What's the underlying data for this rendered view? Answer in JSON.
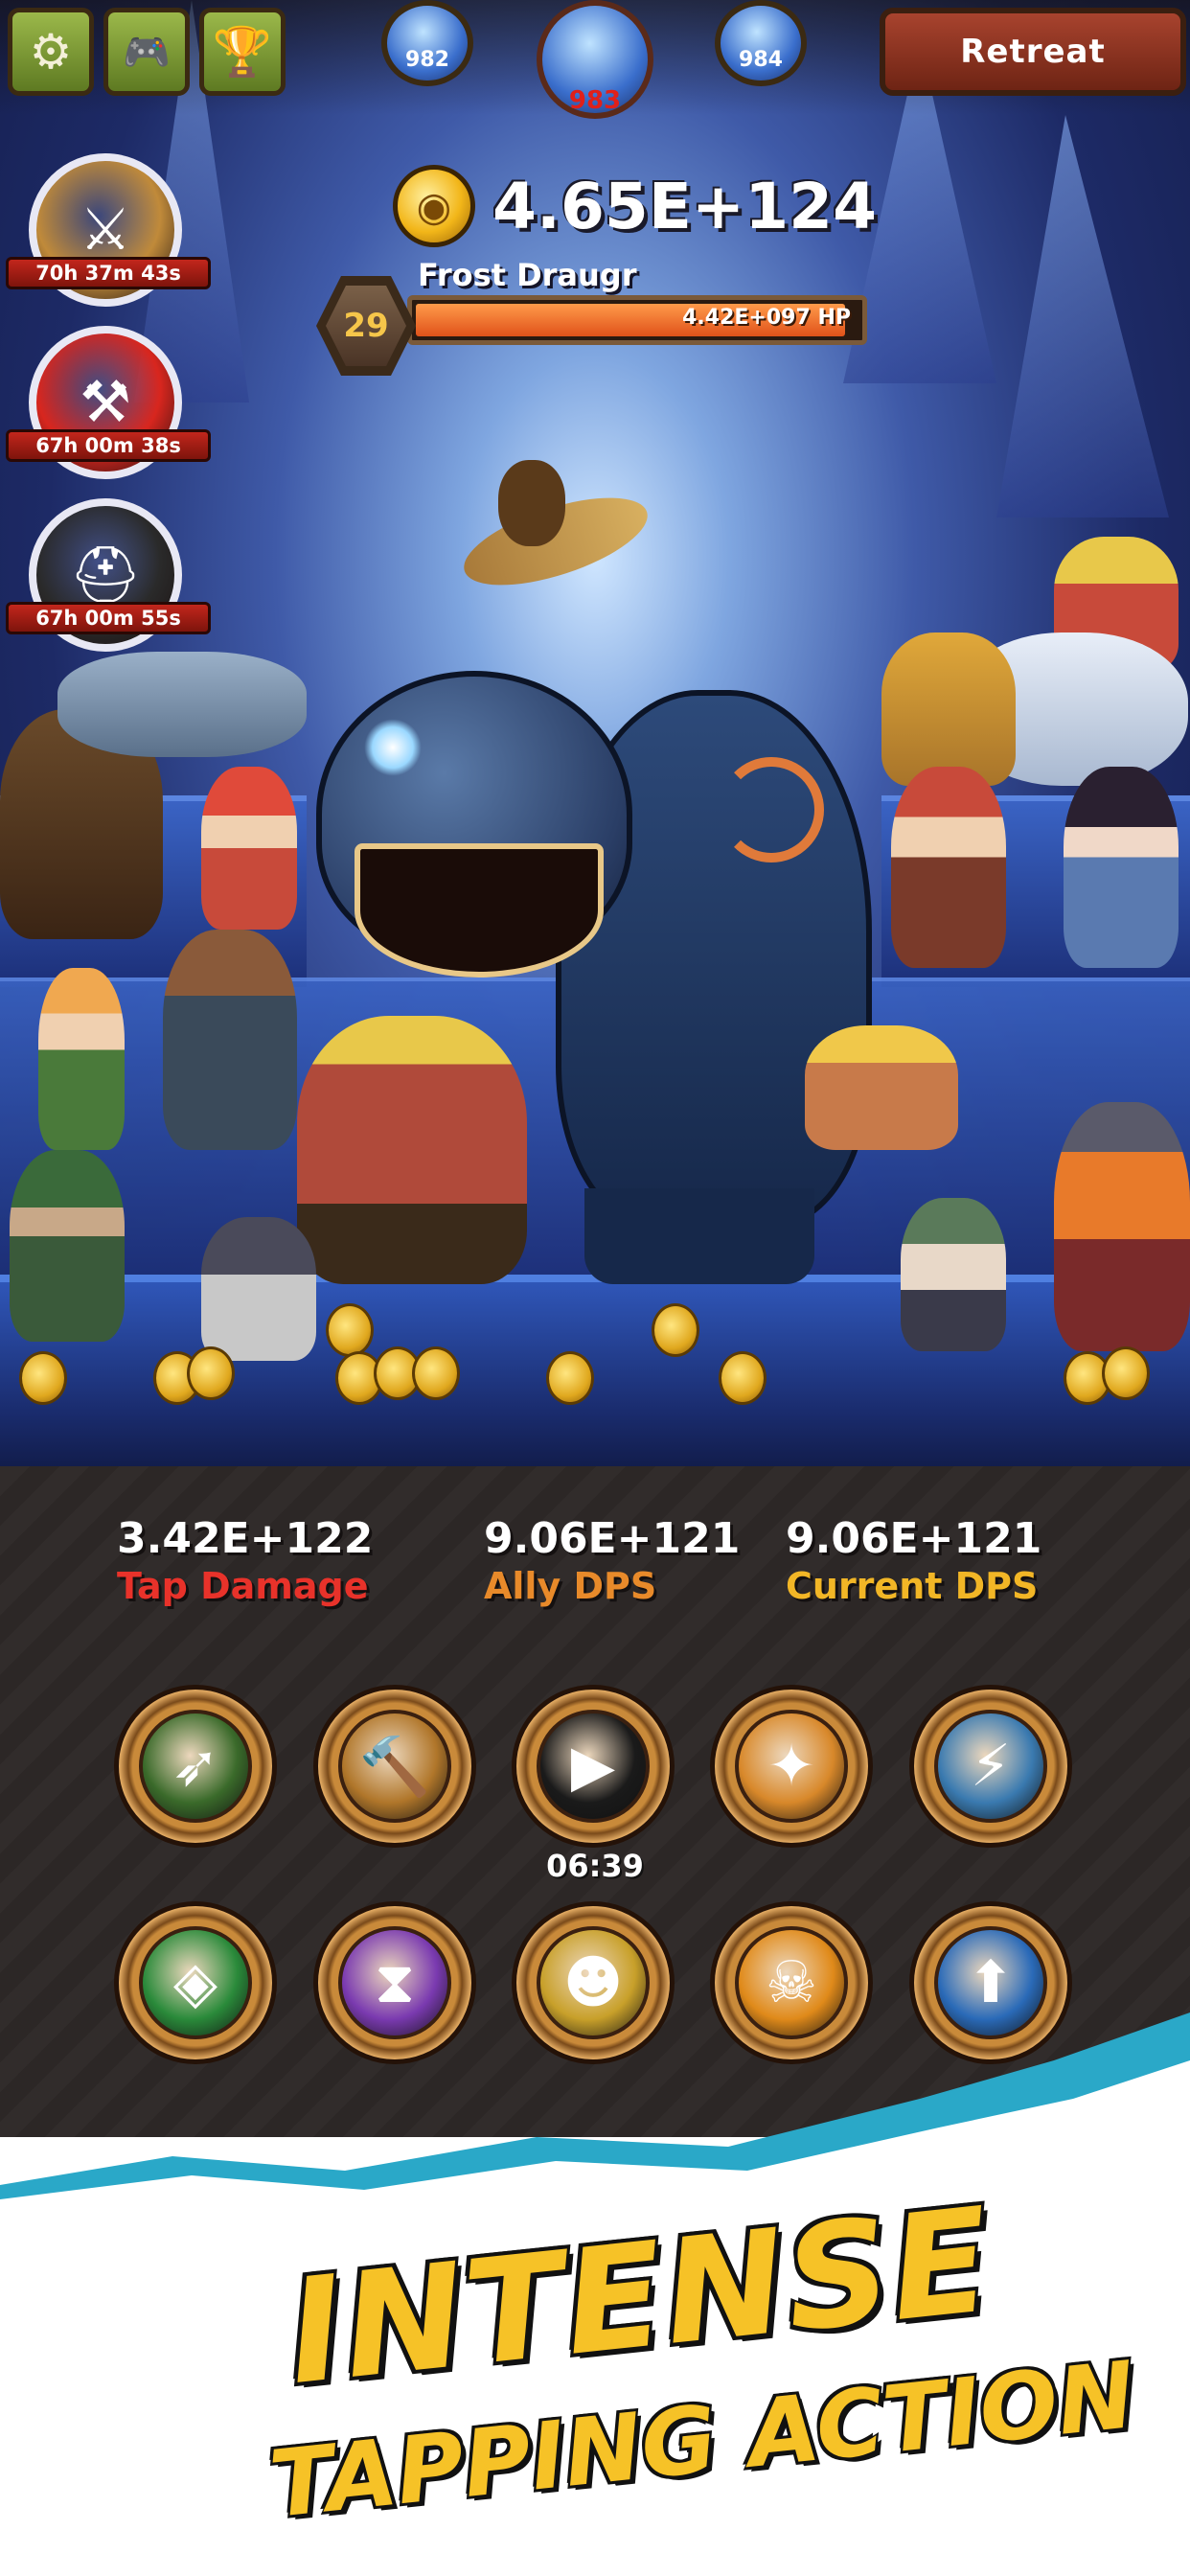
{
  "top_bar": {
    "settings_icon": "gear-icon",
    "controller_icon": "gamepad-icon",
    "trophy_icon": "trophy-icon",
    "stage_prev": "982",
    "stage_current": "983",
    "stage_next": "984",
    "retreat_label": "Retreat"
  },
  "timers": [
    {
      "icon": "sword-skill-icon",
      "time": "70h 37m 43s",
      "color": "#c08a3a"
    },
    {
      "icon": "hammer-skill-icon",
      "time": "67h 00m 38s",
      "color": "#d8261e"
    },
    {
      "icon": "helmet-skill-icon",
      "time": "67h 00m 55s",
      "color": "#2a2a2a"
    }
  ],
  "boss": {
    "gold": "4.65E+124",
    "name": "Frost Draugr",
    "level": "29",
    "hp_text": "4.42E+097 HP",
    "hp_fraction": 0.97
  },
  "stats": [
    {
      "value": "3.42E+122",
      "label": "Tap Damage",
      "color": "#e8322a"
    },
    {
      "value": "9.06E+121",
      "label": "Ally DPS",
      "color": "#e88a2a"
    },
    {
      "value": "9.06E+121",
      "label": "Current DPS",
      "color": "#f2b626"
    }
  ],
  "skills_row1": [
    {
      "name": "shadow-clone-skill-icon",
      "glyph": "➶",
      "bg": "#3a6a2a"
    },
    {
      "name": "hammer-skill-icon",
      "glyph": "🔨",
      "bg": "#b0762a"
    },
    {
      "name": "video-play-skill-icon",
      "glyph": "▶",
      "bg": "#1a1a1a"
    },
    {
      "name": "gold-rain-skill-icon",
      "glyph": "✦",
      "bg": "#d8882a"
    },
    {
      "name": "lightning-fist-skill-icon",
      "glyph": "⚡",
      "bg": "#3a7ab0"
    }
  ],
  "skills_row2": [
    {
      "name": "cube-skill-icon",
      "glyph": "◈",
      "bg": "#2a8a3a"
    },
    {
      "name": "hourglass-skill-icon",
      "glyph": "⧗",
      "bg": "#7a3ab0"
    },
    {
      "name": "midas-skill-icon",
      "glyph": "☻",
      "bg": "#c8a02a"
    },
    {
      "name": "skull-burst-skill-icon",
      "glyph": "☠",
      "bg": "#e08a1a"
    },
    {
      "name": "arrow-up-skill-icon",
      "glyph": "⬆",
      "bg": "#2a6ab8"
    }
  ],
  "skill_timer": "06:39",
  "banner": {
    "line1": "INTENSE",
    "line2": "TAPPING ACTION"
  }
}
